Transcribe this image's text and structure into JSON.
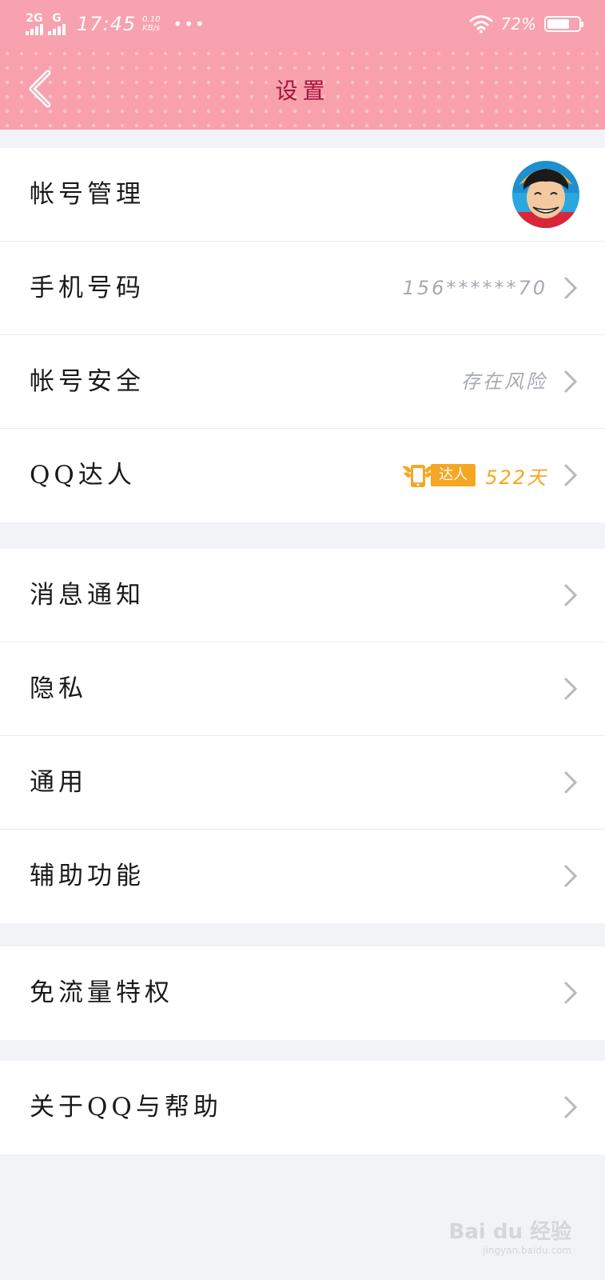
{
  "status_bar": {
    "net1": "2G",
    "net2": "G",
    "time": "17:45",
    "speed_value": "0.10",
    "speed_unit": "KB/s",
    "more": "•••",
    "battery_text": "72%",
    "battery_level": 0.72
  },
  "nav": {
    "title": "设置",
    "back_icon": "chevron-left-icon"
  },
  "groups": [
    {
      "rows": [
        {
          "label": "帐号管理",
          "value": "",
          "icon": "avatar"
        },
        {
          "label": "手机号码",
          "value": "156******70"
        },
        {
          "label": "帐号安全",
          "value": "存在风险"
        },
        {
          "label": "QQ达人",
          "badge_text": "达人",
          "badge_days": "522天"
        }
      ]
    },
    {
      "rows": [
        {
          "label": "消息通知"
        },
        {
          "label": "隐私"
        },
        {
          "label": "通用"
        },
        {
          "label": "辅助功能"
        }
      ]
    },
    {
      "rows": [
        {
          "label": "免流量特权"
        }
      ]
    },
    {
      "rows": [
        {
          "label": "关于QQ与帮助"
        }
      ]
    }
  ],
  "watermark": {
    "main": "Bai du 经验",
    "sub": "jingyan.baidu.com"
  },
  "colors": {
    "accent": "#f9a0ad",
    "title": "#a3143a",
    "badge": "#f5a623",
    "background": "#f2f3f7"
  }
}
